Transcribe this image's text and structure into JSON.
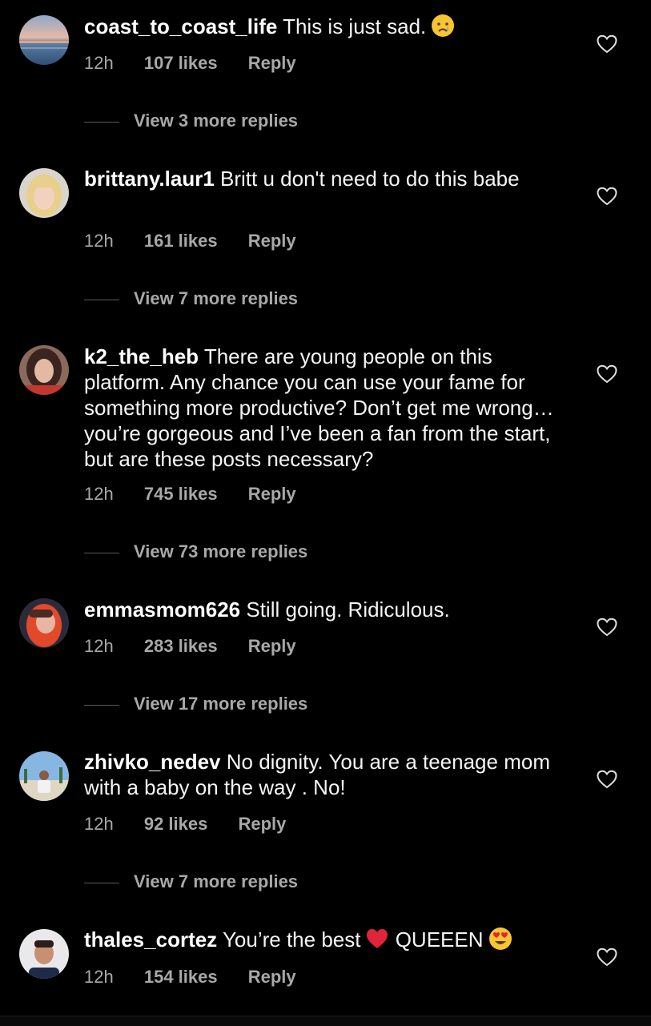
{
  "comments": [
    {
      "username": "coast_to_coast_life",
      "text": "This is just sad.",
      "emoji": "crying-face",
      "time": "12h",
      "likes": "107 likes",
      "reply_label": "Reply",
      "view_replies": "View 3 more replies",
      "avatar": "sunset-avatar"
    },
    {
      "username": "brittany.laur1",
      "text": "Britt u don't need to do this babe",
      "time": "12h",
      "likes": "161 likes",
      "reply_label": "Reply",
      "view_replies": "View 7 more replies",
      "avatar": "blonde-woman-avatar"
    },
    {
      "username": "k2_the_heb",
      "text": "There are young people on this platform. Any chance you can use your fame for something more productive? Don’t get me wrong…you’re gorgeous and I’ve been a fan from the start, but are these posts necessary?",
      "time": "12h",
      "likes": "745 likes",
      "reply_label": "Reply",
      "view_replies": "View 73 more replies",
      "avatar": "brunette-woman-avatar"
    },
    {
      "username": "emmasmom626",
      "text": "Still going. Ridiculous.",
      "time": "12h",
      "likes": "283 likes",
      "reply_label": "Reply",
      "view_replies": "View 17 more replies",
      "avatar": "redhead-woman-avatar"
    },
    {
      "username": "zhivko_nedev",
      "text": "No dignity. You are a teenage mom with a baby on the way . No!",
      "time": "12h",
      "likes": "92 likes",
      "reply_label": "Reply",
      "view_replies": "View 7 more replies",
      "avatar": "beach-man-avatar"
    },
    {
      "username": "thales_cortez",
      "text": "You’re the best",
      "emoji": "red-heart",
      "text_after": "QUEEEN",
      "emoji_after": "heart-eyes-face",
      "time": "12h",
      "likes": "154 likes",
      "reply_label": "Reply",
      "avatar": "young-man-avatar"
    }
  ],
  "colors": {
    "background": "#000000",
    "text": "#f5f5f5",
    "secondary": "#a8a8a8",
    "divider": "#5a5a5a"
  }
}
